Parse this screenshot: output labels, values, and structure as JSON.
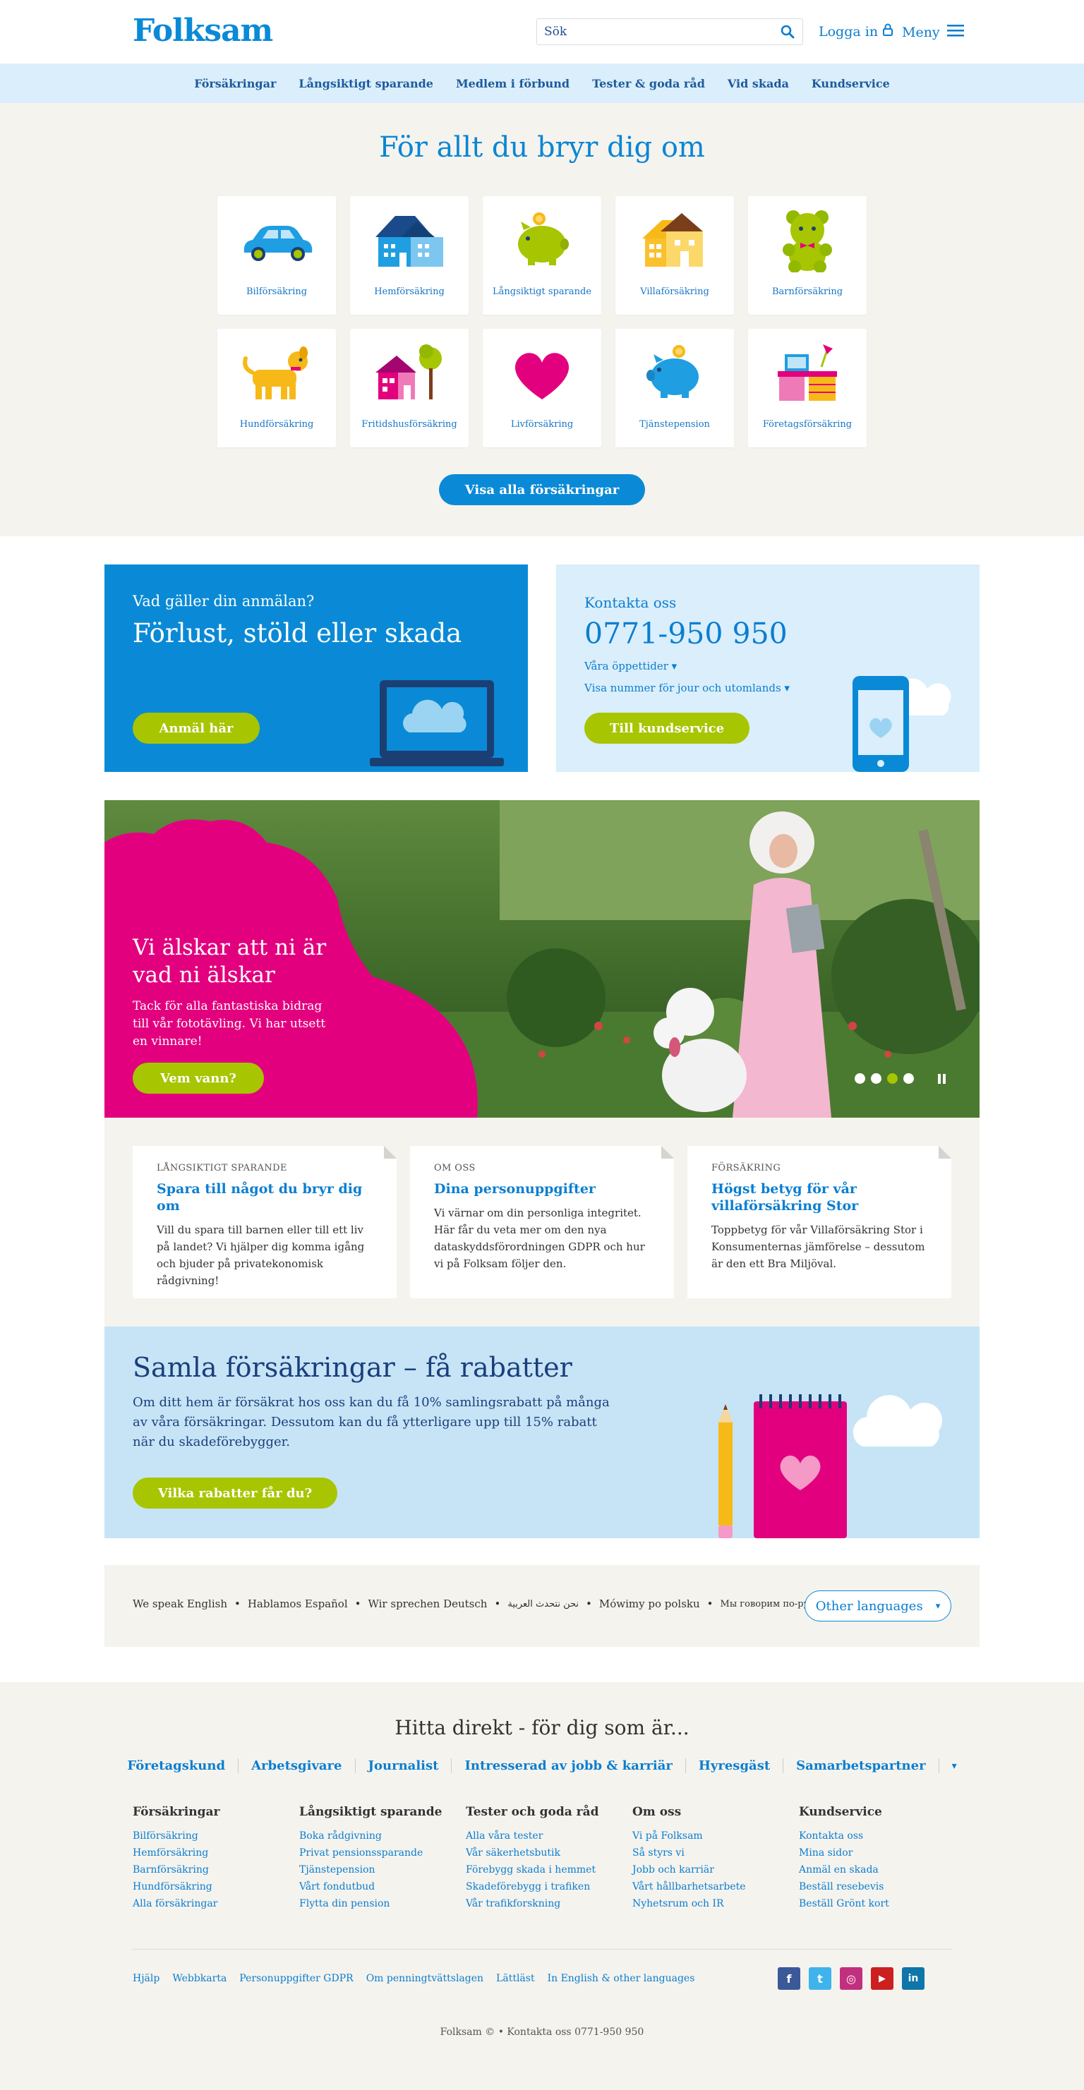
{
  "header": {
    "logo": "Folksam",
    "search_placeholder": "Sök",
    "login": "Logga in",
    "menu": "Meny"
  },
  "nav": [
    "Försäkringar",
    "Långsiktigt sparande",
    "Medlem i förbund",
    "Tester & goda råd",
    "Vid skada",
    "Kundservice"
  ],
  "insurance": {
    "title": "För allt du bryr dig om",
    "tiles": [
      {
        "label": "Bilförsäkring",
        "icon": "car-icon"
      },
      {
        "label": "Hemförsäkring",
        "icon": "apartment-icon"
      },
      {
        "label": "Långsiktigt sparande",
        "icon": "piggy-bank-green-icon"
      },
      {
        "label": "Villaförsäkring",
        "icon": "house-icon"
      },
      {
        "label": "Barnförsäkring",
        "icon": "teddy-bear-icon"
      },
      {
        "label": "Hundförsäkring",
        "icon": "dog-icon"
      },
      {
        "label": "Fritidshusförsäkring",
        "icon": "cottage-icon"
      },
      {
        "label": "Livförsäkring",
        "icon": "heart-icon"
      },
      {
        "label": "Tjänstepension",
        "icon": "piggy-bank-blue-icon"
      },
      {
        "label": "Företagsförsäkring",
        "icon": "office-desk-icon"
      }
    ],
    "show_all": "Visa alla försäkringar"
  },
  "claim": {
    "question": "Vad gäller din anmälan?",
    "title": "Förlust, stöld eller skada",
    "button": "Anmäl här"
  },
  "contact": {
    "title": "Kontakta oss",
    "phone": "0771-950 950",
    "link_hours": "Våra öppettider ▾",
    "link_numbers": "Visa nummer för jour och utomlands ▾",
    "button": "Till kundservice"
  },
  "hero": {
    "title": "Vi älskar att ni är vad ni älskar",
    "body": "Tack för alla fantastiska bidrag till vår fototävling. Vi har utsett en vinnare!",
    "button": "Vem vann?",
    "slides": 4,
    "active_slide": 3
  },
  "news": [
    {
      "category": "LÅNGSIKTIGT SPARANDE",
      "title": "Spara till något du bryr dig om",
      "body": "Vill du spara till barnen eller till ett liv på landet? Vi hjälper dig komma igång och bjuder på privatekonomisk rådgivning!"
    },
    {
      "category": "OM OSS",
      "title": "Dina personuppgifter",
      "body": "Vi värnar om din personliga integritet. Här får du veta mer om den nya dataskyddsförordningen GDPR och hur vi på Folksam följer den."
    },
    {
      "category": "FÖRSÄKRING",
      "title": "Högst betyg för vår villaförsäkring Stor",
      "body": "Toppbetyg för vår Villaförsäkring Stor i Konsumenternas jämförelse – dessutom är den ett Bra Miljöval."
    }
  ],
  "discount": {
    "title": "Samla försäkringar – få rabatter",
    "body": "Om ditt hem är försäkrat hos oss kan du få 10% samlingsrabatt på många av våra försäkringar. Dessutom kan du få ytterligare upp till 15% rabatt när du skadeförebygger.",
    "button": "Vilka rabatter får du?"
  },
  "languages": {
    "items": [
      "We speak English",
      "Hablamos Español",
      "Wir sprechen Deutsch",
      "نحن نتحدث العربية",
      "Mówimy po polsku",
      "Мы говорим по-русски"
    ],
    "other": "Other languages",
    "other_arrow": "▾"
  },
  "footer": {
    "title": "Hitta direkt - för dig som är...",
    "quick": [
      "Företagskund",
      "Arbetsgivare",
      "Journalist",
      "Intresserad av jobb & karriär",
      "Hyresgäst",
      "Samarbetspartner"
    ],
    "quick_arrow": "▾",
    "columns": [
      {
        "heading": "Försäkringar",
        "links": [
          "Bilförsäkring",
          "Hemförsäkring",
          "Barnförsäkring",
          "Hundförsäkring",
          "Alla försäkringar"
        ]
      },
      {
        "heading": "Långsiktigt sparande",
        "links": [
          "Boka rådgivning",
          "Privat pensionssparande",
          "Tjänstepension",
          "Vårt fondutbud",
          "Flytta din pension"
        ]
      },
      {
        "heading": "Tester och goda råd",
        "links": [
          "Alla våra tester",
          "Vår säkerhetsbutik",
          "Förebygg skada i hemmet",
          "Skadeförebygg i trafiken",
          "Vår trafikforskning"
        ]
      },
      {
        "heading": "Om oss",
        "links": [
          "Vi på Folksam",
          "Så styrs vi",
          "Jobb och karriär",
          "Vårt hållbarhetsarbete",
          "Nyhetsrum och IR"
        ]
      },
      {
        "heading": "Kundservice",
        "links": [
          "Kontakta oss",
          "Mina sidor",
          "Anmäl en skada",
          "Beställ resebevis",
          "Beställ Grönt kort"
        ]
      }
    ],
    "small_links": [
      "Hjälp",
      "Webbkarta",
      "Personuppgifter GDPR",
      "Om penningtvättslagen",
      "Lättläst",
      "In English & other languages"
    ],
    "social": [
      {
        "icon": "facebook-icon",
        "glyph": "f",
        "color": "#3b5998"
      },
      {
        "icon": "twitter-icon",
        "glyph": "t",
        "color": "#3fb4ec"
      },
      {
        "icon": "instagram-icon",
        "glyph": "◎",
        "color": "#c1307e"
      },
      {
        "icon": "youtube-icon",
        "glyph": "▶",
        "color": "#cc1f1f"
      },
      {
        "icon": "linkedin-icon",
        "glyph": "in",
        "color": "#0e76a8"
      }
    ],
    "copyright": "Folksam © •  Kontakta oss  0771-950 950"
  },
  "colors": {
    "brand_blue": "#0a8ad6",
    "light_blue": "#daeefb",
    "green": "#a7c500",
    "magenta": "#e3007e",
    "beige": "#f5f3ee"
  }
}
